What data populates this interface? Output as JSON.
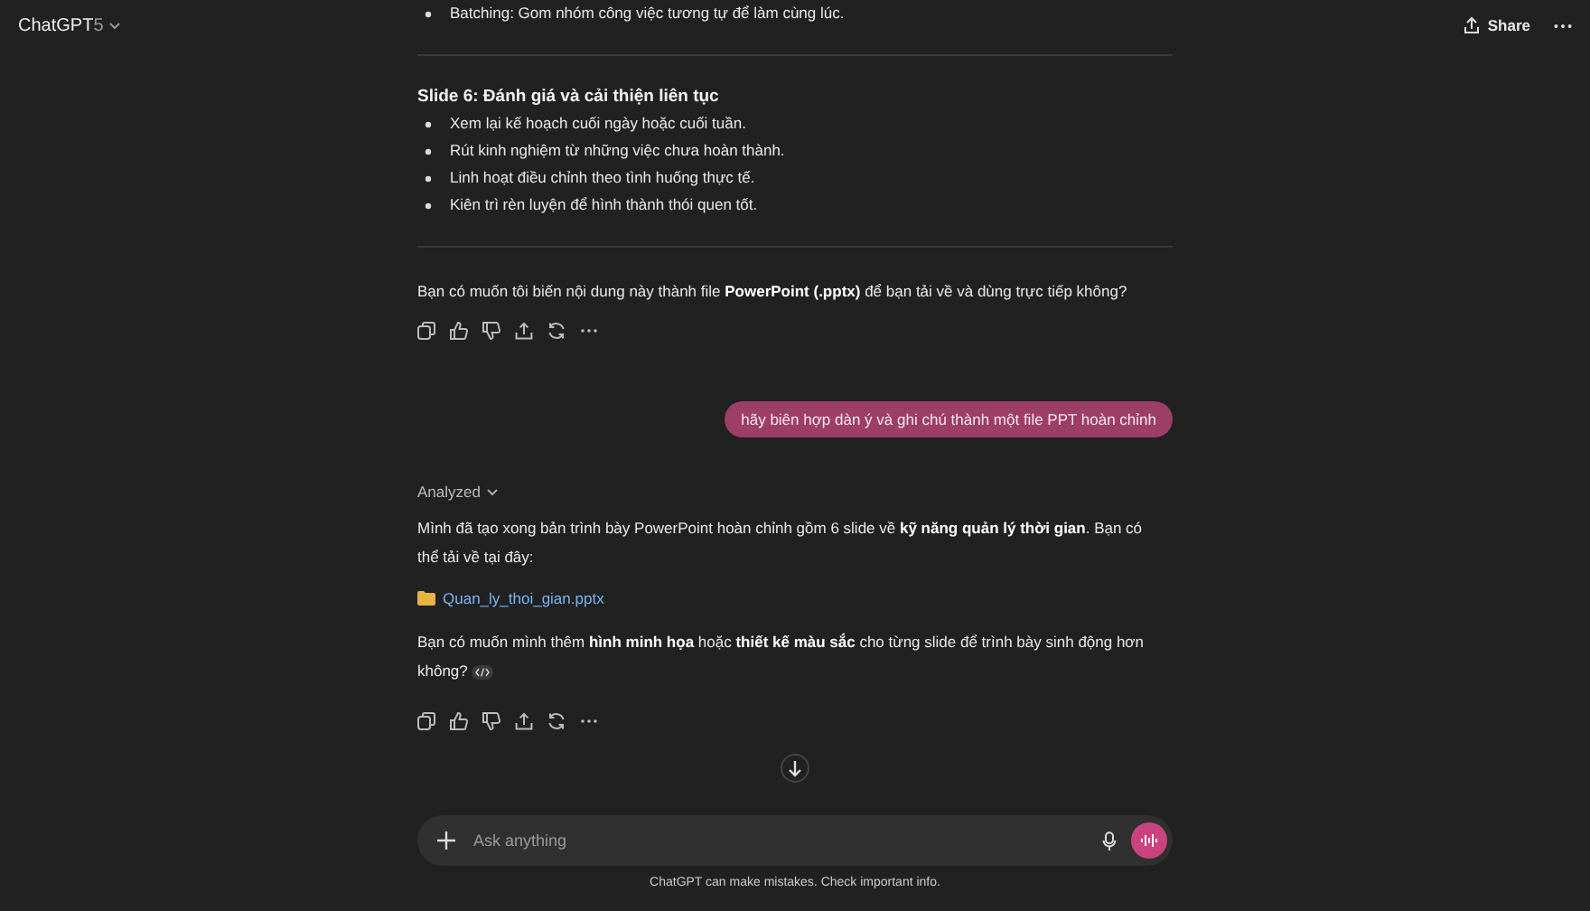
{
  "header": {
    "model": "ChatGPT",
    "version": "5",
    "share": "Share"
  },
  "messages": [
    {
      "kind": "assistant",
      "blocks": [
        {
          "kind": "list",
          "items": [
            "Batching: Gom nhóm công việc tương tự để làm cùng lúc."
          ]
        },
        {
          "kind": "rule"
        },
        {
          "kind": "heading",
          "text": "Slide 6: Đánh giá và cải thiện liên tục"
        },
        {
          "kind": "list",
          "items": [
            "Xem lại kế hoạch cuối ngày hoặc cuối tuần.",
            "Rút kinh nghiệm từ những việc chưa hoàn thành.",
            "Linh hoạt điều chỉnh theo tình huống thực tế.",
            "Kiên trì rèn luyện để hình thành thói quen tốt."
          ]
        },
        {
          "kind": "rule"
        },
        {
          "kind": "paragraph",
          "text": "Bạn có muốn tôi biến nội dung này thành file **PowerPoint (.pptx)** để bạn tải về và dùng trực tiếp không?"
        }
      ]
    },
    {
      "kind": "user",
      "text": "hãy biên hợp dàn ý và ghi chú thành một file PPT hoàn chỉnh"
    },
    {
      "kind": "assistant",
      "blocks": [
        {
          "kind": "analyzed",
          "text": "Analyzed"
        },
        {
          "kind": "paragraph",
          "text": "Mình đã tạo xong bản trình bày PowerPoint hoàn chỉnh gồm 6 slide về **kỹ năng quản lý thời gian**. Bạn có thể tải về tại đây:"
        },
        {
          "kind": "file",
          "text": "Quan_ly_thoi_gian.pptx"
        },
        {
          "kind": "paragraph",
          "text": "Bạn có muốn mình thêm **hình minh họa** hoặc **thiết kế màu sắc** cho từng slide để trình bày sinh động hơn không?",
          "code_badge": true
        }
      ]
    }
  ],
  "composer": {
    "placeholder": "Ask anything"
  },
  "footer": "ChatGPT can make mistakes. Check important info."
}
